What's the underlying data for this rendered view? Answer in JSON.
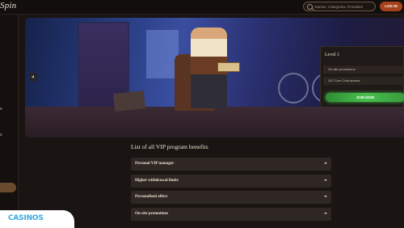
{
  "header": {
    "logo_text": "Spin",
    "search_placeholder": "Games, Categories, Providers",
    "login_label": "LOG IN"
  },
  "sidebar": {
    "fragments": [
      "s",
      "s"
    ]
  },
  "hero": {
    "level_card": {
      "title": "Level 1",
      "rows": [
        "On site promotions",
        "24/7 Live Chat access"
      ],
      "join_label": "JOIN NOW"
    }
  },
  "vip": {
    "title": "List of all VIP program benefits",
    "items": [
      "Personal VIP manager",
      "Higher withdrawal limits",
      "Personalised offers",
      "On-site promotions"
    ]
  },
  "watermark": {
    "text": "CASINOS"
  }
}
